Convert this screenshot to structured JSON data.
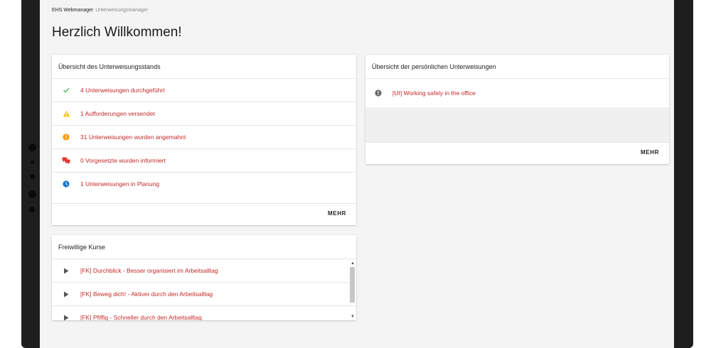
{
  "breadcrumb": {
    "app": "EHS Webmanager",
    "module": "Unterweisungsmanager"
  },
  "page_title": "Herzlich Willkommen!",
  "status_card": {
    "title": "Übersicht des Unterweisungsstands",
    "items": [
      {
        "icon": "checkmark-icon",
        "color": "#4caf50",
        "label": "4 Unterweisungen durchgeführt"
      },
      {
        "icon": "warning-icon",
        "color": "#f9c82b",
        "label": "1 Aufforderungen versendet"
      },
      {
        "icon": "alert-circle-icon",
        "color": "#f39c12",
        "label": "31 Unterweisungen wurden angemahnt"
      },
      {
        "icon": "chat-bubbles-icon",
        "color": "#e53935",
        "label": "0 Vorgesetzte wurden informiert"
      },
      {
        "icon": "clock-icon",
        "color": "#1976d2",
        "label": "1 Unterweisungen in Planung"
      }
    ],
    "more_label": "MEHR"
  },
  "personal_card": {
    "title": "Übersicht der persönlichen Unterweisungen",
    "items": [
      {
        "icon": "info-circle-icon",
        "color": "#6b6b6b",
        "label": "[UI] Working safely in the office"
      }
    ],
    "more_label": "MEHR"
  },
  "courses_card": {
    "title": "Freiwillige Kurse",
    "items": [
      {
        "icon": "play-icon",
        "label": "[FK] Durchblick - Besser organisiert im Arbeitsalltag"
      },
      {
        "icon": "play-icon",
        "label": "[FK] Beweg dich! - Aktiver durch den Arbeitsalltag"
      },
      {
        "icon": "play-icon",
        "label": "[FK] Pfiffig - Schneller durch den Arbeitsalltag"
      }
    ]
  },
  "colors": {
    "link": "#c62828",
    "background": "#f4f4f4"
  }
}
